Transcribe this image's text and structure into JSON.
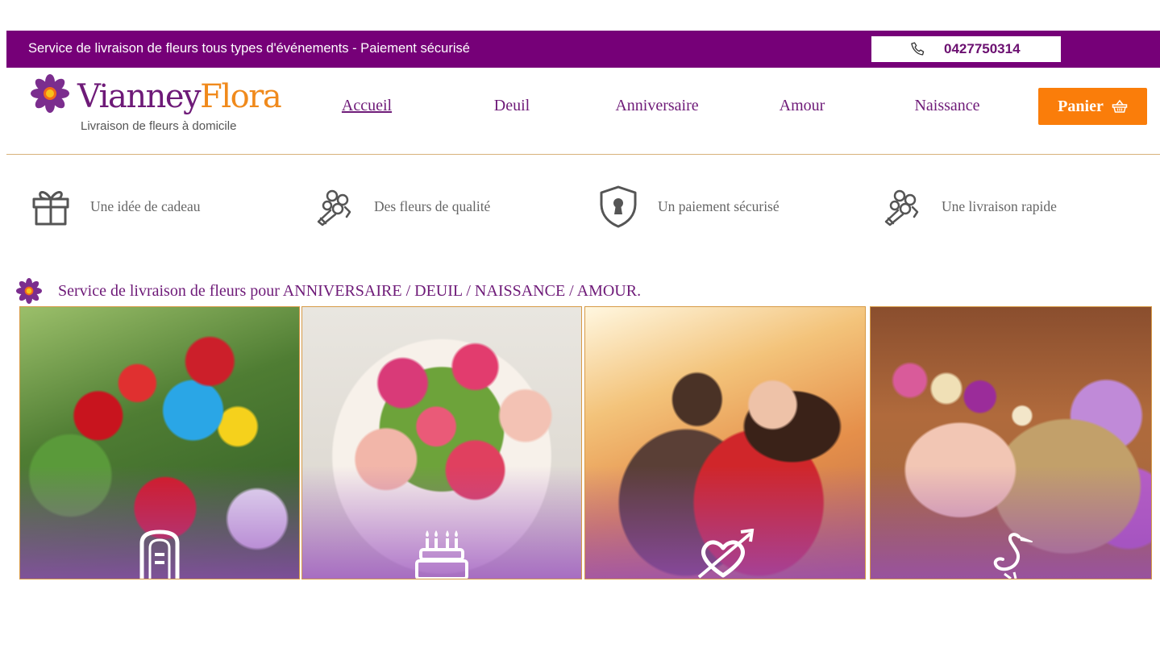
{
  "topbar": {
    "text": "Service de livraison de fleurs tous types d'événements - Paiement sécurisé",
    "phone": "0427750314",
    "phone_icon": "phone-icon"
  },
  "logo": {
    "name_part1": "Vianney",
    "name_part2": "Flora",
    "tagline": "Livraison de fleurs à domicile",
    "icon": "flower-icon"
  },
  "nav": {
    "items": [
      {
        "label": "Accueil",
        "active": true
      },
      {
        "label": "Deuil",
        "active": false
      },
      {
        "label": "Anniversaire",
        "active": false
      },
      {
        "label": "Amour",
        "active": false
      },
      {
        "label": "Naissance",
        "active": false
      }
    ],
    "cart_label": "Panier",
    "cart_icon": "basket-icon"
  },
  "features": [
    {
      "label": "Une idée de cadeau",
      "icon": "gift-icon"
    },
    {
      "label": "Des fleurs de qualité",
      "icon": "bouquet-icon"
    },
    {
      "label": "Un paiement sécurisé",
      "icon": "shield-lock-icon"
    },
    {
      "label": "Une livraison rapide",
      "icon": "bouquet-icon"
    }
  ],
  "section": {
    "title": "Service de livraison de fleurs pour ANNIVERSAIRE / DEUIL / NAISSANCE / AMOUR."
  },
  "cards": [
    {
      "category": "deuil",
      "icon": "tombstone-icon"
    },
    {
      "category": "anniversaire",
      "icon": "birthday-cake-icon"
    },
    {
      "category": "amour",
      "icon": "heart-arrow-icon"
    },
    {
      "category": "naissance",
      "icon": "stork-icon"
    }
  ],
  "colors": {
    "brand_purple": "#760078",
    "accent_orange": "#fa7d0a",
    "logo_orange": "#f08a1c",
    "card_border": "#d79a46"
  }
}
